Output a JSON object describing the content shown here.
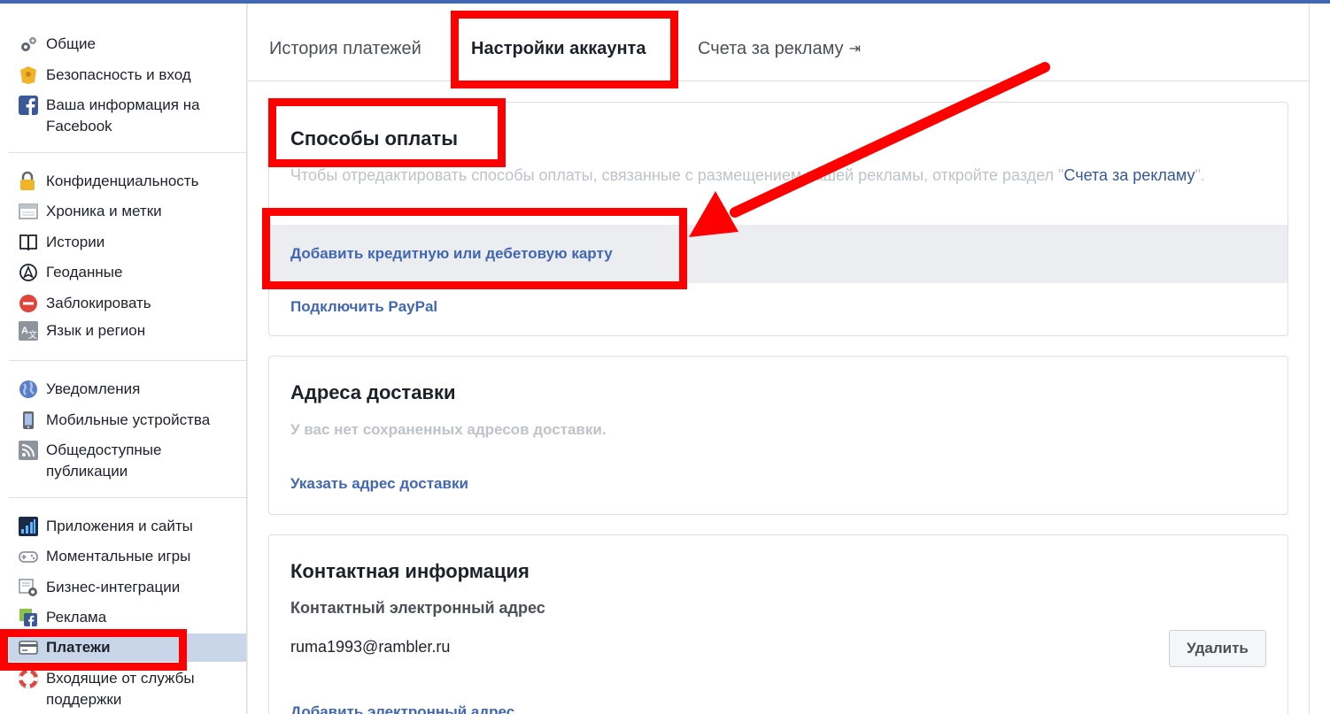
{
  "colors": {
    "fb_blue": "#4267b2",
    "link_blue": "#365899",
    "active_bg": "#c9d6ea",
    "annotation_red": "#ff0000"
  },
  "sidebar": {
    "groups": [
      {
        "items": [
          {
            "label": "Общие",
            "icon": "gears-icon"
          },
          {
            "label": "Безопасность и вход",
            "icon": "shield-badge-icon"
          },
          {
            "label": "Ваша информация на\nFacebook",
            "icon": "facebook-logo-icon"
          }
        ]
      },
      {
        "items": [
          {
            "label": "Конфиденциальность",
            "icon": "lock-icon"
          },
          {
            "label": "Хроника и метки",
            "icon": "timeline-icon"
          },
          {
            "label": "Истории",
            "icon": "book-icon"
          },
          {
            "label": "Геоданные",
            "icon": "location-icon"
          },
          {
            "label": "Заблокировать",
            "icon": "block-icon"
          },
          {
            "label": "Язык и регион",
            "icon": "language-icon"
          }
        ]
      },
      {
        "items": [
          {
            "label": "Уведомления",
            "icon": "globe-icon"
          },
          {
            "label": "Мобильные устройства",
            "icon": "phone-icon"
          },
          {
            "label": "Общедоступные\nпубликации",
            "icon": "rss-icon"
          }
        ]
      },
      {
        "items": [
          {
            "label": "Приложения и сайты",
            "icon": "apps-icon"
          },
          {
            "label": "Моментальные игры",
            "icon": "gamepad-icon"
          },
          {
            "label": "Бизнес-интеграции",
            "icon": "business-gear-icon"
          },
          {
            "label": "Реклама",
            "icon": "ads-icon"
          },
          {
            "label": "Платежи",
            "icon": "card-icon",
            "active": true
          },
          {
            "label": "Входящие от службы\nподдержки",
            "icon": "lifebuoy-icon"
          }
        ]
      }
    ]
  },
  "tabs": [
    {
      "label": "История платежей"
    },
    {
      "label": "Настройки аккаунта",
      "active": true
    },
    {
      "label": "Счета за рекламу",
      "external_icon": "⇥"
    }
  ],
  "payment_methods": {
    "title": "Способы оплаты",
    "desc_before": "Чтобы отредактировать способы оплаты, связанные с размещением вашей рекламы, откройте раздел \"",
    "desc_link": "Счета за рекламу",
    "desc_after": "\".",
    "add_card": "Добавить кредитную или дебетовую карту",
    "connect_paypal": "Подключить PayPal"
  },
  "shipping": {
    "title": "Адреса доставки",
    "empty": "У вас нет сохраненных адресов доставки.",
    "add_link": "Указать адрес доставки"
  },
  "contact": {
    "title": "Контактная информация",
    "email_label": "Контактный электронный адрес",
    "email_value": "ruma1993@rambler.ru",
    "delete_button": "Удалить",
    "add_email": "Добавить электронный адрес"
  }
}
